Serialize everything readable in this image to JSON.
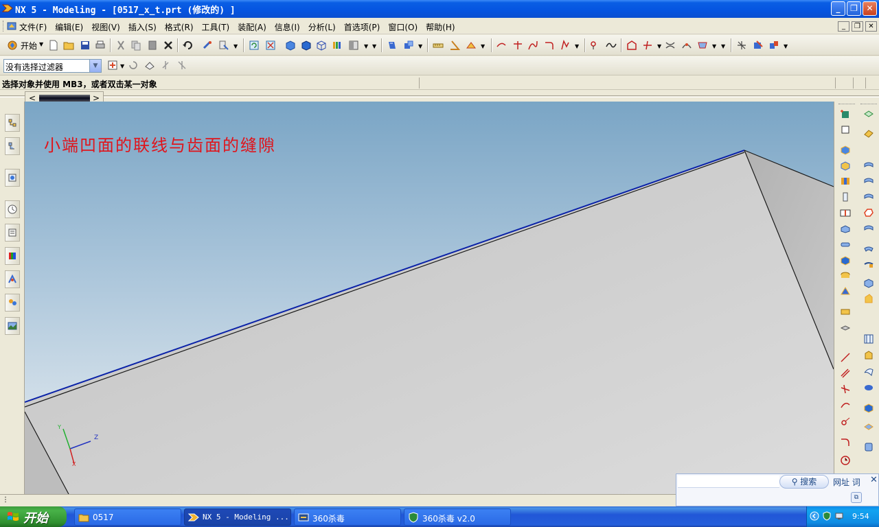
{
  "window": {
    "title": "NX 5 - Modeling - [0517_x_t.prt (修改的) ]",
    "controls": {
      "minimize": "_",
      "maximize": "❐",
      "close": "✕"
    }
  },
  "menubar": {
    "items": [
      "文件(F)",
      "编辑(E)",
      "视图(V)",
      "插入(S)",
      "格式(R)",
      "工具(T)",
      "装配(A)",
      "信息(I)",
      "分析(L)",
      "首选项(P)",
      "窗口(O)",
      "帮助(H)"
    ],
    "mdi_controls": {
      "minimize": "_",
      "restore": "❐",
      "close": "✕"
    }
  },
  "toolbar": {
    "start_label": "开始",
    "selection_filter": {
      "value": "没有选择过滤器"
    }
  },
  "prompt": {
    "text": "选择对象并使用 MB3，或者双击某一对象"
  },
  "tab_scroller": {
    "left": "<",
    "right": ">"
  },
  "viewport": {
    "annotation": "小端凹面的联线与齿面的缝隙",
    "triad": {
      "x": "X",
      "y": "Y",
      "z": "Z"
    }
  },
  "search_widget": {
    "search_label": "搜索",
    "url_word_label": "网址 词",
    "close": "✕"
  },
  "taskbar": {
    "start_label": "开始",
    "tasks": [
      {
        "label": "0517",
        "icon": "folder-icon"
      },
      {
        "label": "NX 5 - Modeling ...",
        "icon": "nx-icon"
      },
      {
        "label": "360杀毒",
        "icon": "antivirus-icon"
      },
      {
        "label": "360杀毒 v2.0",
        "icon": "shield-icon"
      }
    ],
    "clock": "9:54"
  },
  "colors": {
    "title_bar": "#0554e0",
    "annotation": "#e0141b",
    "highlight_edge": "#0a22a8",
    "start_button": "#3c9a3c"
  }
}
